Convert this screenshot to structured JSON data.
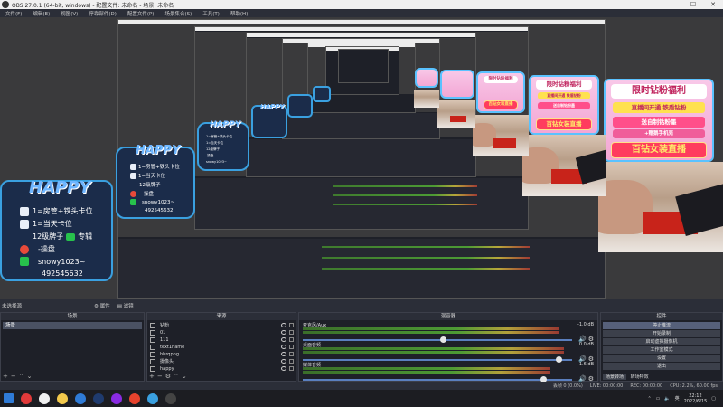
{
  "window": {
    "title": "OBS 27.0.1 (64-bit, windows) - 配置文件: 未命名 - 场景: 未命名",
    "controls": [
      "—",
      "☐",
      "✕"
    ]
  },
  "menu": [
    "文件(F)",
    "编辑(E)",
    "视图(V)",
    "停靠部件(D)",
    "配置文件(P)",
    "场景集合(S)",
    "工具(T)",
    "帮助(H)"
  ],
  "overlay_card": {
    "title": "HAPPY",
    "lines": [
      "1=房管+铁头卡位",
      "1=当天卡位",
      "12级牌子",
      "专辑",
      "-操盘",
      "snowy1023~",
      "492545632"
    ]
  },
  "promo": {
    "header": "限时钻粉福利",
    "line1": "直播间开通 铁盾钻粉",
    "line2": "送自制钻粉墨",
    "line3": "+赠鹅手机壳",
    "banner": "百钻女装直播"
  },
  "dock": {
    "no_source": "未选择源",
    "props": "属性",
    "filters": "滤镜",
    "scenes_header": "场景",
    "scenes": [
      "场景"
    ],
    "sources_header": "来源",
    "sources": [
      "钻粉",
      "01",
      "111",
      "text1name",
      "hhrqpng",
      "摄像头",
      "happy"
    ],
    "mixer_header": "混音器",
    "mixer": [
      {
        "name": "麦克风/Aux",
        "db": "-1.0 dB",
        "level": 0.93,
        "fader": 0.52
      },
      {
        "name": "桌面音频",
        "db": "0.0 dB",
        "level": 0.95,
        "fader": 0.96
      },
      {
        "name": "媒体音频",
        "db": "-1.6 dB",
        "level": 0.9,
        "fader": 0.9
      }
    ],
    "mixer_scale": [
      "-60",
      "-55",
      "-50",
      "-45",
      "-40",
      "-35",
      "-30",
      "-25",
      "-20",
      "-15",
      "-10",
      "-5",
      "0"
    ],
    "controls_header": "控件",
    "controls": [
      "停止推流",
      "开始录制",
      "启动虚拟摄像机",
      "工作室模式",
      "设置",
      "退出"
    ],
    "tabs": [
      "场景转场",
      "转场特效"
    ]
  },
  "status": {
    "items": [
      "丢帧 0 (0.0%)",
      "LIVE: 00:00:00",
      "REC: 00:00:00",
      "CPU: 2.2%, 60.00 fps"
    ]
  },
  "taskbar": {
    "time": "22:12",
    "date": "2022/6/15",
    "icons": [
      "windows-icon",
      "netease-icon",
      "obs-icon",
      "explorer-icon",
      "bilibili-icon",
      "steam-icon",
      "app-icon",
      "chrome-icon",
      "photos-icon",
      "obs2-icon"
    ],
    "colors": [
      "#2f7bd6",
      "#e13a3a",
      "#f0f0f0",
      "#f2c94c",
      "#2f7bd6",
      "#1f3b6e",
      "#8a2be2",
      "#e7432d",
      "#3aa0e0",
      "#444"
    ]
  }
}
